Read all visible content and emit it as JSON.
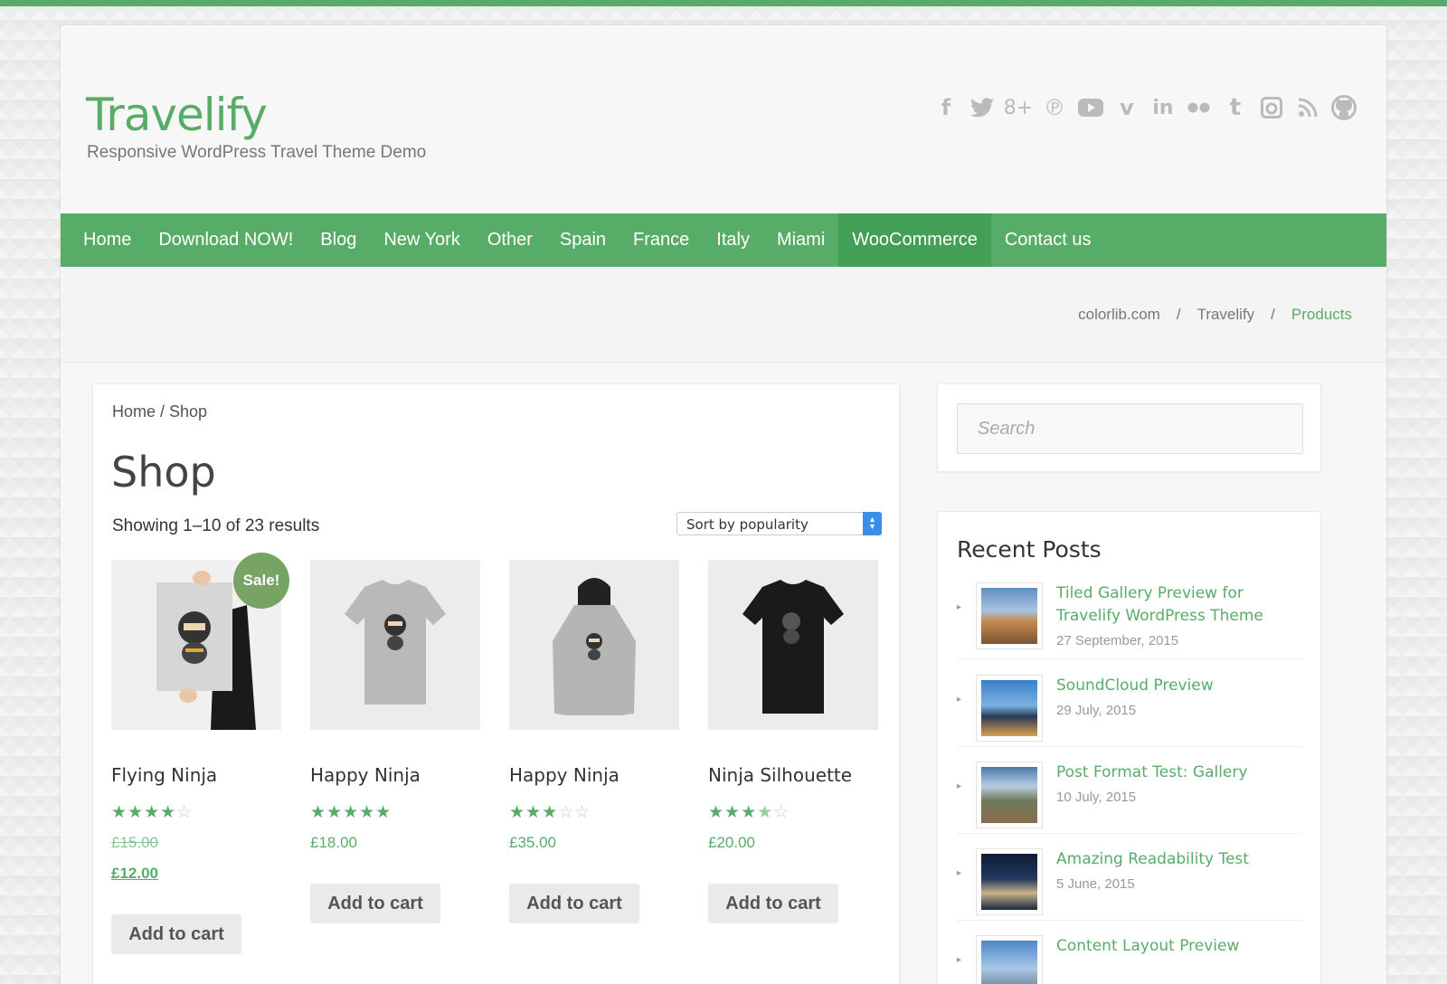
{
  "site": {
    "title": "Travelify",
    "description": "Responsive WordPress Travel Theme Demo",
    "accent": "#57ad68"
  },
  "social_icons": [
    "facebook-icon",
    "twitter-icon",
    "google-plus-icon",
    "pinterest-icon",
    "youtube-icon",
    "vimeo-icon",
    "linkedin-icon",
    "flickr-icon",
    "tumblr-icon",
    "instagram-icon",
    "rss-icon",
    "github-icon"
  ],
  "nav": {
    "items": [
      {
        "label": "Home"
      },
      {
        "label": "Download NOW!"
      },
      {
        "label": "Blog"
      },
      {
        "label": "New York"
      },
      {
        "label": "Other"
      },
      {
        "label": "Spain"
      },
      {
        "label": "France"
      },
      {
        "label": "Italy"
      },
      {
        "label": "Miami"
      },
      {
        "label": "WooCommerce",
        "active": true
      },
      {
        "label": "Contact us"
      }
    ]
  },
  "breadcrumb": {
    "items": [
      "colorlib.com",
      "/",
      "Travelify",
      "/",
      "Products"
    ]
  },
  "shop": {
    "crumb": "Home / Shop",
    "title": "Shop",
    "result_count": "Showing 1–10 of 23 results",
    "sort_selected": "Sort by popularity",
    "products": [
      {
        "name": "Flying Ninja",
        "rating": 4,
        "old_price": "£15.00",
        "price": "£12.00",
        "sale_badge": "Sale!",
        "button": "Add to cart"
      },
      {
        "name": "Happy Ninja",
        "rating": 5,
        "price": "£18.00",
        "button": "Add to cart"
      },
      {
        "name": "Happy Ninja",
        "rating": 3,
        "price": "£35.00",
        "button": "Add to cart"
      },
      {
        "name": "Ninja Silhouette",
        "rating": 3.5,
        "price": "£20.00",
        "button": "Add to cart"
      }
    ]
  },
  "sidebar": {
    "search_placeholder": "Search",
    "recent_posts_title": "Recent Posts",
    "posts": [
      {
        "title": "Tiled Gallery Preview for Travelify WordPress Theme",
        "date": "27 September, 2015"
      },
      {
        "title": "SoundCloud Preview",
        "date": "29 July, 2015"
      },
      {
        "title": "Post Format Test: Gallery",
        "date": "10 July, 2015"
      },
      {
        "title": "Amazing Readability Test",
        "date": "5 June, 2015"
      },
      {
        "title": "Content Layout Preview",
        "date": ""
      }
    ]
  }
}
